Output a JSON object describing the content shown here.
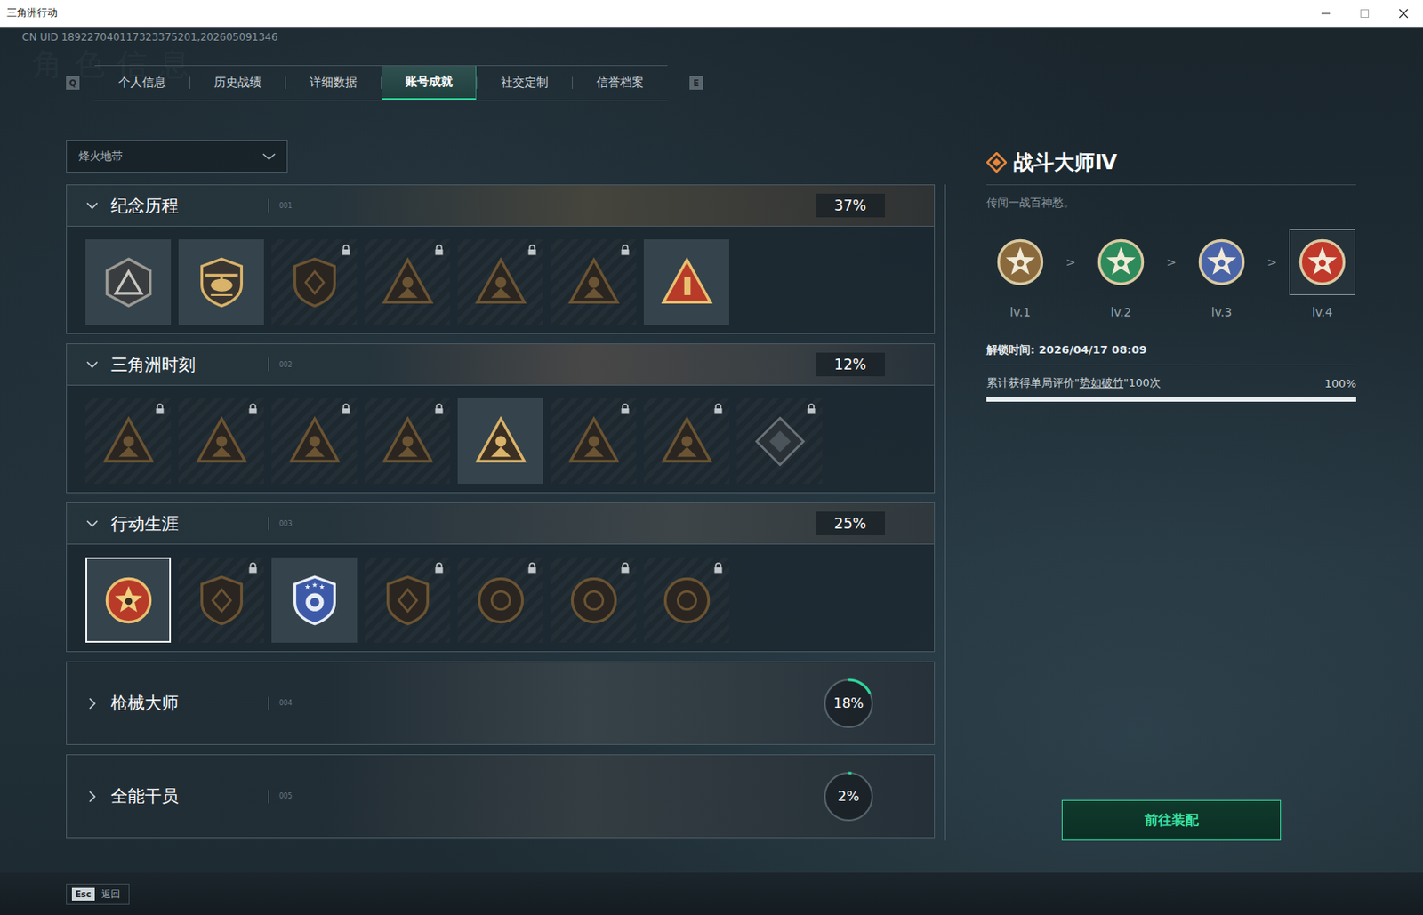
{
  "window": {
    "title": "三角洲行动"
  },
  "uid": "CN UID 189227040117323375201,202605091346",
  "watermark": "角色信息",
  "tab_keys": {
    "prev": "Q",
    "next": "E"
  },
  "tabs": [
    {
      "label": "个人信息",
      "selected": false
    },
    {
      "label": "历史战绩",
      "selected": false
    },
    {
      "label": "详细数据",
      "selected": false
    },
    {
      "label": "账号成就",
      "selected": true
    },
    {
      "label": "社交定制",
      "selected": false
    },
    {
      "label": "信誉档案",
      "selected": false
    }
  ],
  "mode_dropdown": {
    "value": "烽火地带"
  },
  "sections": [
    {
      "title": "纪念历程",
      "code": "001",
      "percent": "37%",
      "expanded": true,
      "badges": [
        {
          "locked": false,
          "selected": false
        },
        {
          "locked": false,
          "selected": false
        },
        {
          "locked": true,
          "selected": false
        },
        {
          "locked": true,
          "selected": false
        },
        {
          "locked": true,
          "selected": false
        },
        {
          "locked": true,
          "selected": false
        },
        {
          "locked": false,
          "selected": false
        }
      ]
    },
    {
      "title": "三角洲时刻",
      "code": "002",
      "percent": "12%",
      "expanded": true,
      "badges": [
        {
          "locked": true,
          "selected": false
        },
        {
          "locked": true,
          "selected": false
        },
        {
          "locked": true,
          "selected": false
        },
        {
          "locked": true,
          "selected": false
        },
        {
          "locked": false,
          "selected": false
        },
        {
          "locked": true,
          "selected": false
        },
        {
          "locked": true,
          "selected": false
        },
        {
          "locked": true,
          "selected": false
        }
      ]
    },
    {
      "title": "行动生涯",
      "code": "003",
      "percent": "25%",
      "expanded": true,
      "badges": [
        {
          "locked": false,
          "selected": true
        },
        {
          "locked": true,
          "selected": false
        },
        {
          "locked": false,
          "selected": false
        },
        {
          "locked": true,
          "selected": false
        },
        {
          "locked": true,
          "selected": false
        },
        {
          "locked": true,
          "selected": false
        },
        {
          "locked": true,
          "selected": false
        }
      ]
    },
    {
      "title": "枪械大师",
      "code": "004",
      "percent": "18%",
      "expanded": false,
      "level": 0.18
    },
    {
      "title": "全能干员",
      "code": "005",
      "percent": "2%",
      "expanded": false,
      "level": 0.02
    }
  ],
  "detail": {
    "title": "战斗大师Ⅳ",
    "description": "传闻一战百神愁。",
    "separator": ">",
    "levels": [
      {
        "label": "lv.1",
        "color": "#8a6a3c",
        "selected": false
      },
      {
        "label": "lv.2",
        "color": "#2e8a5a",
        "selected": false
      },
      {
        "label": "lv.3",
        "color": "#4a64a8",
        "selected": false
      },
      {
        "label": "lv.4",
        "color": "#c0392b",
        "selected": true
      }
    ],
    "unlock_time": "解锁时间: 2026/04/17 08:09",
    "requirement": {
      "prefix": "累计获得单局评价\"",
      "highlight": "势如破竹",
      "suffix": "\"100次",
      "percent": "100%",
      "level": 1
    },
    "button": "前往装配"
  },
  "footer": {
    "key": "Esc",
    "label": "返回"
  }
}
